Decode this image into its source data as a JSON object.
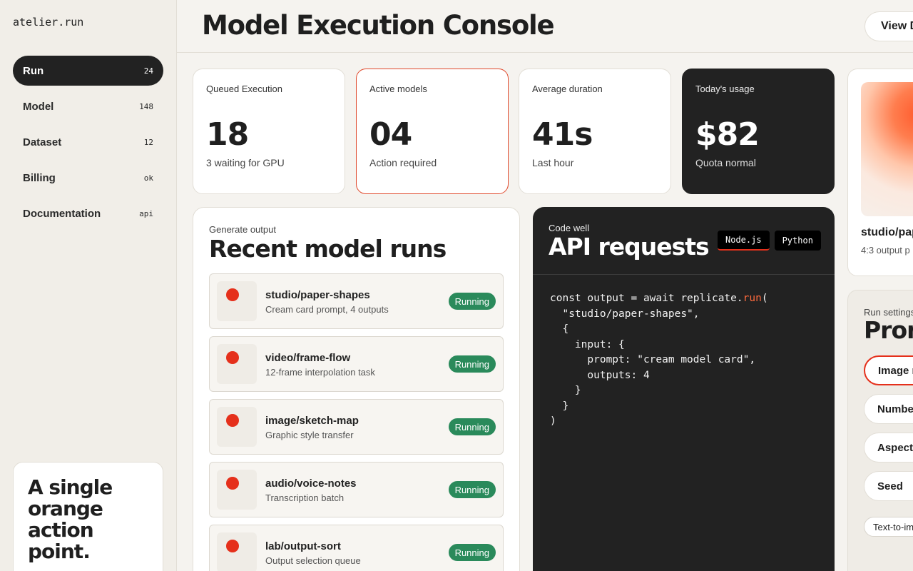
{
  "brand": "atelier.run",
  "nav": [
    {
      "label": "Run",
      "count": "24",
      "active": true
    },
    {
      "label": "Model",
      "count": "148"
    },
    {
      "label": "Dataset",
      "count": "12"
    },
    {
      "label": "Billing",
      "count": "ok"
    },
    {
      "label": "Documentation",
      "count": "api"
    }
  ],
  "promo": {
    "text": "A single orange action point."
  },
  "header": {
    "title": "Model Execution Console",
    "view_button": "View D"
  },
  "stats": [
    {
      "label": "Queued Execution",
      "value": "18",
      "sub": "3 waiting for GPU"
    },
    {
      "label": "Active models",
      "value": "04",
      "sub": "Action required"
    },
    {
      "label": "Average duration",
      "value": "41s",
      "sub": "Last hour"
    },
    {
      "label": "Today's usage",
      "value": "$82",
      "sub": "Quota normal"
    }
  ],
  "runs": {
    "eyebrow": "Generate output",
    "title": "Recent model runs",
    "items": [
      {
        "name": "studio/paper-shapes",
        "desc": "Cream card prompt, 4 outputs",
        "status": "Running"
      },
      {
        "name": "video/frame-flow",
        "desc": "12-frame interpolation task",
        "status": "Running"
      },
      {
        "name": "image/sketch-map",
        "desc": "Graphic style transfer",
        "status": "Running"
      },
      {
        "name": "audio/voice-notes",
        "desc": "Transcription batch",
        "status": "Running"
      },
      {
        "name": "lab/output-sort",
        "desc": "Output selection queue",
        "status": "Running"
      }
    ]
  },
  "code": {
    "eyebrow": "Code well",
    "title": "API requests",
    "tabs": [
      "Node.js",
      "Python"
    ],
    "line1_prefix": "const output = await replicate.",
    "line1_fn": "run",
    "line1_suffix": "(",
    "lines": [
      "  \"studio/paper-shapes\",",
      "  {",
      "    input: {",
      "      prompt: \"cream model card\",",
      "      outputs: 4",
      "    }",
      "  }",
      ")"
    ]
  },
  "preview": {
    "title": "studio/pap",
    "sub": "4:3 output p"
  },
  "settings": {
    "eyebrow": "Run settings",
    "title": "Pron",
    "fields": [
      "Image r",
      "Number",
      "Aspect",
      "Seed"
    ],
    "chip": "Text-to-im"
  },
  "colors": {
    "accent": "#e5301b",
    "dark": "#222222",
    "running": "#2a8a5b",
    "background": "#f5f3ef"
  }
}
